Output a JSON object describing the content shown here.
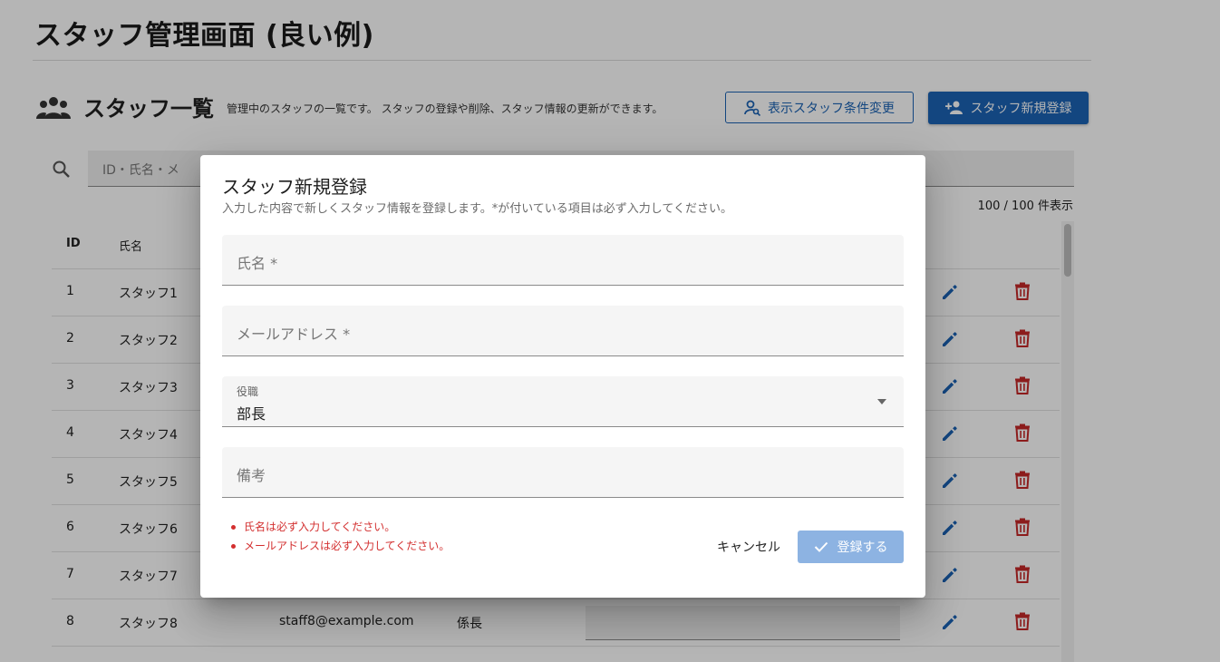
{
  "page": {
    "title": "スタッフ管理画面 (良い例)"
  },
  "section": {
    "title": "スタッフ一覧",
    "description": "管理中のスタッフの一覧です。 スタッフの登録や削除、スタッフ情報の更新ができます。",
    "filter_button": "表示スタッフ条件変更",
    "add_button": "スタッフ新規登録"
  },
  "search": {
    "placeholder": "ID・氏名・メ"
  },
  "count": "100 / 100 件表示",
  "table": {
    "headers": {
      "id": "ID",
      "name": "氏名"
    },
    "rows": [
      {
        "id": "1",
        "name": "スタッフ1",
        "email": "",
        "position": ""
      },
      {
        "id": "2",
        "name": "スタッフ2",
        "email": "",
        "position": ""
      },
      {
        "id": "3",
        "name": "スタッフ3",
        "email": "",
        "position": ""
      },
      {
        "id": "4",
        "name": "スタッフ4",
        "email": "",
        "position": ""
      },
      {
        "id": "5",
        "name": "スタッフ5",
        "email": "",
        "position": ""
      },
      {
        "id": "6",
        "name": "スタッフ6",
        "email": "",
        "position": ""
      },
      {
        "id": "7",
        "name": "スタッフ7",
        "email": "",
        "position": ""
      },
      {
        "id": "8",
        "name": "スタッフ8",
        "email": "staff8@example.com",
        "position": "係長"
      }
    ]
  },
  "dialog": {
    "title": "スタッフ新規登録",
    "description": "入力した内容で新しくスタッフ情報を登録します。*が付いている項目は必ず入力してください。",
    "fields": {
      "name_label": "氏名 *",
      "email_label": "メールアドレス *",
      "role_label": "役職",
      "role_value": "部長",
      "note_label": "備考"
    },
    "errors": [
      "氏名は必ず入力してください。",
      "メールアドレスは必ず入力してください。"
    ],
    "cancel_label": "キャンセル",
    "submit_label": "登録する"
  },
  "colors": {
    "primary": "#1b63b5",
    "edit_icon": "#1b63b5",
    "delete_icon": "#c62828",
    "error": "#d32f2f",
    "submit_disabled": "#8db3e2"
  },
  "icons": {
    "section": "group-icon",
    "filter": "person-search-icon",
    "add": "person-add-icon",
    "search": "search-icon",
    "edit": "pencil-icon",
    "delete": "trash-icon",
    "dropdown": "caret-down-icon",
    "submit": "check-icon"
  }
}
